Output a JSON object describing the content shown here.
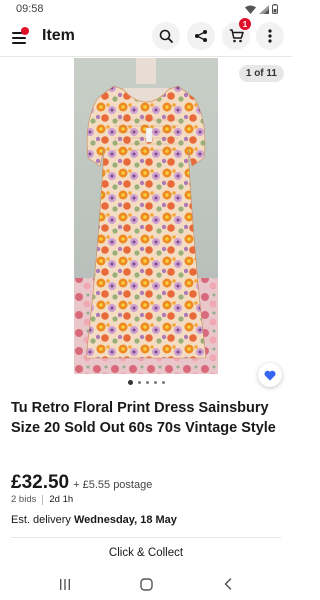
{
  "status_bar": {
    "time": "09:58"
  },
  "header": {
    "title": "Item",
    "cart_count": "1"
  },
  "gallery": {
    "counter": "1 of 11",
    "image_alt": "Floral print dress on mannequin",
    "dots_total": 5,
    "dots_active_index": 0
  },
  "product": {
    "title": "Tu Retro Floral Print Dress Sainsbury Size 20 Sold Out 60s 70s Vintage Style",
    "price": "£32.50",
    "postage": "+ £5.55 postage",
    "bids": "2 bids",
    "time_left": "2d 1h",
    "delivery_prefix": "Est. delivery",
    "delivery_date": "Wednesday, 18 May"
  },
  "actions": {
    "click_collect": "Click & Collect"
  },
  "colors": {
    "brand_red": "#e0102a",
    "watch_blue": "#3665f3",
    "text": "#191919"
  },
  "icons": [
    "menu-icon",
    "search-icon",
    "share-icon",
    "cart-icon",
    "more-vertical-icon",
    "heart-icon",
    "recents-icon",
    "home-icon",
    "back-icon"
  ]
}
